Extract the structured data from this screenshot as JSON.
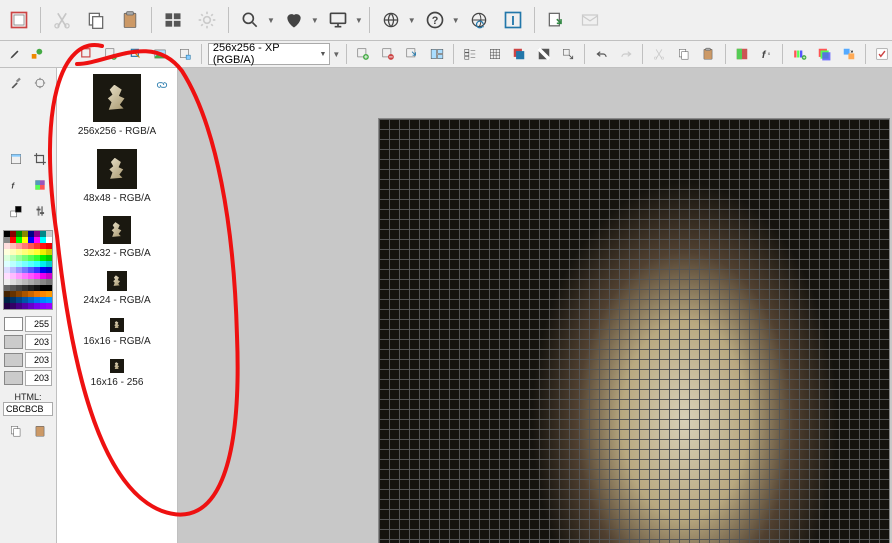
{
  "format_selector": "256x256 - XP (RGB/A)",
  "sizes": [
    {
      "label": "256x256 - RGB/A",
      "dim": 48
    },
    {
      "label": "48x48 - RGB/A",
      "dim": 40
    },
    {
      "label": "32x32 - RGB/A",
      "dim": 28
    },
    {
      "label": "24x24 - RGB/A",
      "dim": 20
    },
    {
      "label": "16x16 - RGB/A",
      "dim": 14
    },
    {
      "label": "16x16 - 256",
      "dim": 14
    }
  ],
  "gray_values": [
    "255",
    "203",
    "203",
    "203"
  ],
  "html_label": "HTML:",
  "html_value": "CBCBCB",
  "palette_colors": [
    "#000",
    "#800",
    "#080",
    "#880",
    "#008",
    "#808",
    "#088",
    "#ccc",
    "#888",
    "#f00",
    "#0f0",
    "#ff0",
    "#00f",
    "#f0f",
    "#0ff",
    "#fff",
    "#fdd",
    "#fbb",
    "#f99",
    "#f77",
    "#f55",
    "#f33",
    "#f11",
    "#e00",
    "#ffd",
    "#ffb",
    "#ff9",
    "#ff7",
    "#ff5",
    "#ff3",
    "#ee0",
    "#cc0",
    "#dfd",
    "#bfb",
    "#9f9",
    "#7f7",
    "#5f5",
    "#3f3",
    "#0e0",
    "#0c0",
    "#dff",
    "#bff",
    "#9ff",
    "#7ff",
    "#5ff",
    "#3ff",
    "#0ee",
    "#0cc",
    "#ddf",
    "#bbf",
    "#99f",
    "#77f",
    "#55f",
    "#33f",
    "#00e",
    "#00c",
    "#fdf",
    "#fbf",
    "#f9f",
    "#f7f",
    "#f5f",
    "#f3f",
    "#e0e",
    "#c0c",
    "#eee",
    "#ddd",
    "#ccc",
    "#bbb",
    "#aaa",
    "#999",
    "#888",
    "#777",
    "#666",
    "#555",
    "#444",
    "#333",
    "#222",
    "#111",
    "#000",
    "#000",
    "#420",
    "#630",
    "#840",
    "#a50",
    "#c60",
    "#e70",
    "#f80",
    "#f90",
    "#024",
    "#036",
    "#048",
    "#05a",
    "#06c",
    "#07e",
    "#08f",
    "#09f",
    "#204",
    "#306",
    "#408",
    "#50a",
    "#60c",
    "#70e",
    "#80f",
    "#90f"
  ]
}
